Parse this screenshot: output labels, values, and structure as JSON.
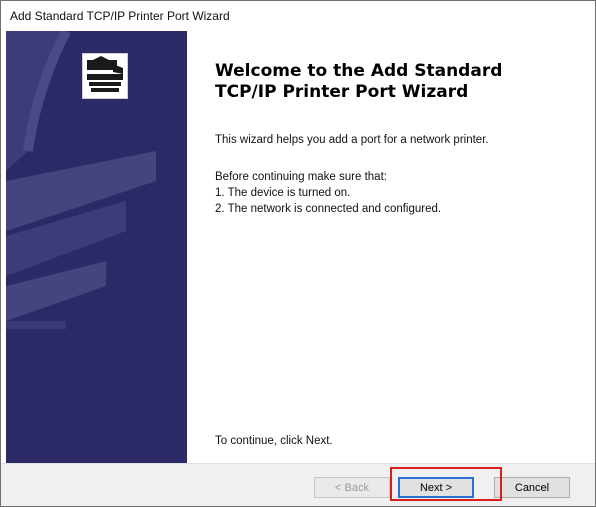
{
  "window": {
    "title": "Add Standard TCP/IP Printer Port Wizard"
  },
  "banner": {
    "icon": "printer-wizard-icon",
    "background_color": "#2b2a67",
    "accent_color": "#4a4a86"
  },
  "main": {
    "heading_line1": "Welcome to the Add Standard",
    "heading_line2": "TCP/IP Printer Port Wizard",
    "intro": "This wizard helps you add a port for a network printer.",
    "prereq_header": "Before continuing make sure that:",
    "prereq_items": [
      "1.  The device is turned on.",
      "2.  The network is connected and configured."
    ],
    "continue_hint": "To continue, click Next."
  },
  "buttons": {
    "back": "< Back",
    "next": "Next >",
    "cancel": "Cancel"
  },
  "highlight_color": "#d81e1e"
}
